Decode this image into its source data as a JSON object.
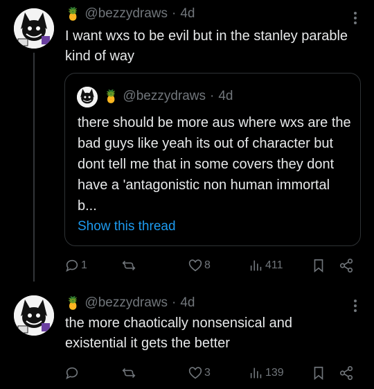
{
  "colors": {
    "background": "#000000",
    "text": "#e7e9ea",
    "muted": "#71767b",
    "link": "#1d9bf0",
    "border": "#2f3336"
  },
  "tweets": [
    {
      "emoji": "🍍",
      "handle": "@bezzydraws",
      "separator": "·",
      "time": "4d",
      "text": "I want wxs to be evil but in the stanley parable kind of way",
      "quote": {
        "emoji": "🍍",
        "handle": "@bezzydraws",
        "separator": "·",
        "time": "4d",
        "text": "there should be more aus where wxs are the bad guys like yeah its out of character but dont tell me that in some covers they dont have a 'antagonistic non human immortal b...",
        "show_thread": "Show this thread"
      },
      "actions": {
        "replies": "1",
        "retweets": "",
        "likes": "8",
        "views": "411"
      }
    },
    {
      "emoji": "🍍",
      "handle": "@bezzydraws",
      "separator": "·",
      "time": "4d",
      "text": "the more chaotically nonsensical and existential it gets the better",
      "actions": {
        "replies": "",
        "retweets": "",
        "likes": "3",
        "views": "139"
      }
    }
  ],
  "icons": [
    "more-icon",
    "reply-icon",
    "retweet-icon",
    "like-icon",
    "views-icon",
    "bookmark-icon",
    "share-icon"
  ]
}
